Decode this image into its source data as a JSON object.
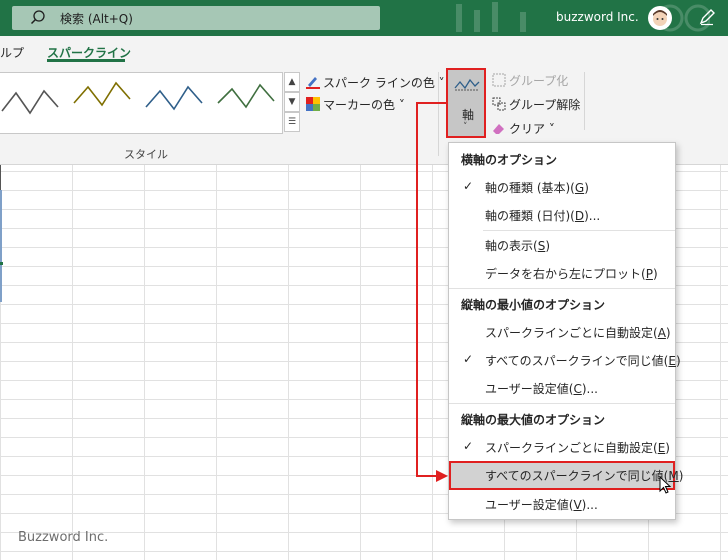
{
  "titlebar": {
    "search_placeholder": "検索 (Alt+Q)",
    "account_name": "buzzword Inc.",
    "bg_color": "#217346"
  },
  "tabs": {
    "partial": "ルプ",
    "active": "スパークライン"
  },
  "ribbon": {
    "style_group_label": "スタイル",
    "sparkline_color": "スパーク ラインの色",
    "marker_color": "マーカーの色",
    "axis": "軸",
    "group": "グループ化",
    "ungroup": "グループ解除",
    "clear": "クリア"
  },
  "menu": {
    "h_axis_header": "横軸のオプション",
    "h_type_general": "軸の種類 (基本)(",
    "h_type_general_key": "G",
    "h_type_date": "軸の種類 (日付)(",
    "h_type_date_key": "D",
    "show_axis": "軸の表示(",
    "show_axis_key": "S",
    "plot_rtl": "データを右から左にプロット(",
    "plot_rtl_key": "P",
    "v_min_header": "縦軸の最小値のオプション",
    "min_auto": "スパークラインごとに自動設定(",
    "min_auto_key": "A",
    "min_same": "すべてのスパークラインで同じ値(",
    "min_same_key": "E",
    "min_custom": "ユーザー設定値(",
    "min_custom_key": "C",
    "v_max_header": "縦軸の最大値のオプション",
    "max_auto": "スパークラインごとに自動設定(",
    "max_auto_key": "E",
    "max_same": "すべてのスパークラインで同じ値(",
    "max_same_key": "M",
    "max_custom": "ユーザー設定値(",
    "max_custom_key": "V",
    "paren_close": ")",
    "paren_ellipsis": ")...",
    "checkmark": "✓"
  },
  "watermark": "Buzzword Inc.",
  "icons": [
    "search-icon",
    "avatar",
    "pen-icon",
    "sparkline-color-icon",
    "marker-color-icon",
    "axis-icon",
    "group-icon",
    "ungroup-icon",
    "clear-icon",
    "mouse-cursor-icon"
  ],
  "colors": {
    "accent": "#217346",
    "highlight_border": "#e02020"
  }
}
